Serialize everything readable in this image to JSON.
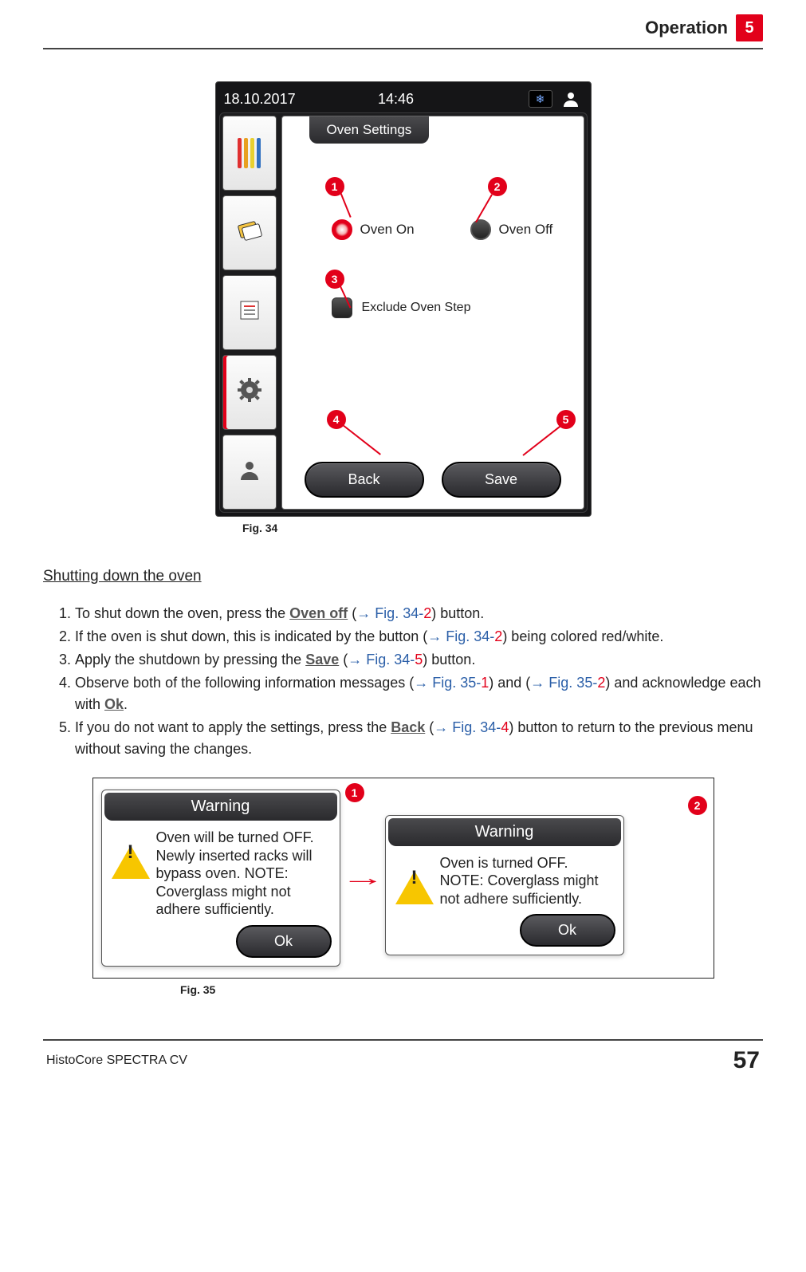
{
  "header": {
    "section": "Operation",
    "chapter": "5"
  },
  "device": {
    "date": "18.10.2017",
    "time": "14:46",
    "title": "Oven Settings",
    "radio_on_label": "Oven On",
    "radio_off_label": "Oven Off",
    "exclude_label": "Exclude Oven Step",
    "back_label": "Back",
    "save_label": "Save",
    "callouts": {
      "c1": "1",
      "c2": "2",
      "c3": "3",
      "c4": "4",
      "c5": "5"
    }
  },
  "fig34_caption": "Fig. 34",
  "section_title": "Shutting down the oven",
  "steps": {
    "s1a": "To shut down the oven, press the ",
    "s1_btn": "Oven off",
    "s1b": " (",
    "s1_ref": "→ Fig. 34-",
    "s1_num": "2",
    "s1c": ") button.",
    "s2a": "If the oven is shut down, this is indicated by the button (",
    "s2_ref": "→ Fig. 34-",
    "s2_num": "2",
    "s2b": ") being colored red/white.",
    "s3a": "Apply the shutdown by pressing the ",
    "s3_btn": "Save",
    "s3b": " (",
    "s3_ref": "→ Fig. 34-",
    "s3_num": "5",
    "s3c": ") button.",
    "s4a": "Observe both of the following information messages (",
    "s4_ref1": "→ Fig. 35-",
    "s4_num1": "1",
    "s4b": ") and (",
    "s4_ref2": "→ Fig. 35-",
    "s4_num2": "2",
    "s4c": ") and acknowledge each with ",
    "s4_btn": "Ok",
    "s4d": ".",
    "s5a": "If you do not want to apply the settings, press the ",
    "s5_btn": "Back",
    "s5b": " (",
    "s5_ref": "→ Fig. 34-",
    "s5_num": "4",
    "s5c": ") button to return to the previous menu without saving the changes."
  },
  "warnings": {
    "title": "Warning",
    "box1_text": "Oven will be turned OFF. Newly inserted racks will bypass oven. NOTE: Coverglass might not adhere sufficiently.",
    "box2_text": "Oven is turned OFF. NOTE: Coverglass might not adhere sufficiently.",
    "ok_label": "Ok",
    "c1": "1",
    "c2": "2"
  },
  "fig35_caption": "Fig. 35",
  "footer": {
    "product": "HistoCore SPECTRA CV",
    "page": "57"
  }
}
